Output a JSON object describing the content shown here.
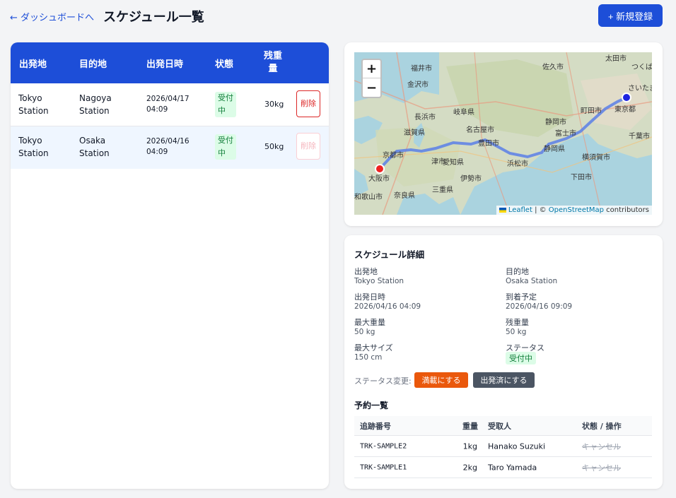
{
  "header": {
    "back_label": "← ダッシュボードへ",
    "title": "スケジュール一覧",
    "new_button": "+ 新規登録"
  },
  "list": {
    "columns": [
      "出発地",
      "目的地",
      "出発日時",
      "状態",
      "残重量"
    ],
    "rows": [
      {
        "origin": "Tokyo Station",
        "destination": "Nagoya Station",
        "departure": "2026/04/17 04:09",
        "status": "受付中",
        "remaining": "30kg",
        "delete": "削除",
        "selected": false
      },
      {
        "origin": "Tokyo Station",
        "destination": "Osaka Station",
        "departure": "2026/04/16 04:09",
        "status": "受付中",
        "remaining": "50kg",
        "delete": "削除",
        "selected": true
      }
    ]
  },
  "map": {
    "zoom_in": "+",
    "zoom_out": "−",
    "attribution_leaflet": "Leaflet",
    "attribution_sep": " | © ",
    "attribution_osm": "OpenStreetMap",
    "attribution_tail": " contributors",
    "labels": [
      "福井市",
      "金沢市",
      "佐久市",
      "太田市",
      "つくば",
      "さいたま",
      "東京都",
      "町田市",
      "名古屋市",
      "豊田市",
      "浜松市",
      "静岡県",
      "富士市",
      "京都市",
      "大阪市",
      "津市",
      "伊勢市",
      "奈良県",
      "和歌山市",
      "滋賀県",
      "長浜市",
      "岐阜県",
      "愛知県",
      "三重県",
      "静岡市",
      "千葉市",
      "横須賀市",
      "下田市"
    ],
    "colors": {
      "route": "#5b7fe8",
      "origin_marker": "#1d24e0",
      "destination_marker": "#ef2222"
    }
  },
  "detail": {
    "title": "スケジュール詳細",
    "fields": {
      "origin_label": "出発地",
      "origin": "Tokyo Station",
      "dest_label": "目的地",
      "dest": "Osaka Station",
      "dep_label": "出発日時",
      "dep": "2026/04/16 04:09",
      "arr_label": "到着予定",
      "arr": "2026/04/16 09:09",
      "maxw_label": "最大重量",
      "maxw": "50 kg",
      "rem_label": "残重量",
      "rem": "50 kg",
      "size_label": "最大サイズ",
      "size": "150 cm",
      "status_label": "ステータス",
      "status": "受付中"
    },
    "status_change_label": "ステータス変更:",
    "btn_full": "満載にする",
    "btn_departed": "出発済にする",
    "reservations_title": "予約一覧",
    "res_columns": [
      "追跡番号",
      "重量",
      "受取人",
      "状態 / 操作"
    ],
    "reservations": [
      {
        "tracking": "TRK-SAMPLE2",
        "weight": "1kg",
        "recipient": "Hanako Suzuki",
        "status": "キャンセル"
      },
      {
        "tracking": "TRK-SAMPLE1",
        "weight": "2kg",
        "recipient": "Taro Yamada",
        "status": "キャンセル"
      }
    ]
  },
  "colors": {
    "primary": "#1d4ed8",
    "danger": "#dc2626",
    "success_bg": "#dcfce7",
    "success_text": "#15803d",
    "orange": "#ea580c",
    "gray": "#4b5563"
  }
}
